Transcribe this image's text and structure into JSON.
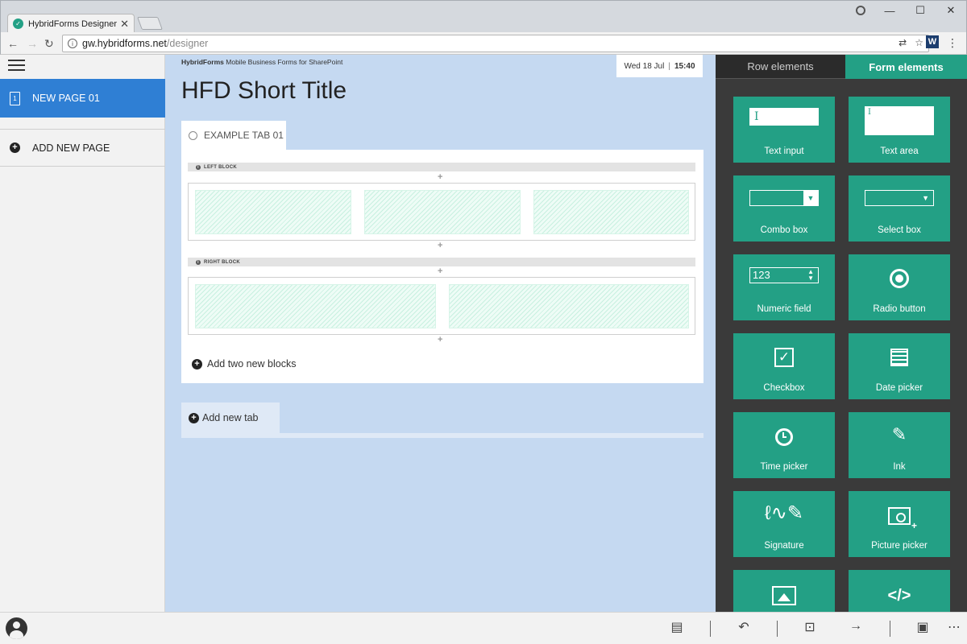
{
  "browser": {
    "tab_title": "HybridForms Designer",
    "tab_close": "✕",
    "url_host": "gw.hybridforms.net",
    "url_path": "/designer",
    "window_controls": {
      "minimize": "—",
      "maximize": "☐",
      "close": "✕"
    },
    "extension_label": "W"
  },
  "sidebar": {
    "pages": [
      {
        "label": "NEW PAGE 01",
        "number": "1",
        "selected": true
      }
    ],
    "add_page_label": "ADD NEW PAGE"
  },
  "canvas": {
    "brand_bold": "HybridForms",
    "brand_rest": " Mobile Business Forms for SharePoint",
    "date": "Wed 18 Jul",
    "date_sep": "|",
    "time": "15:40",
    "title": "HFD Short Title",
    "tab_label": "EXAMPLE TAB 01",
    "blocks": [
      {
        "header": "LEFT BLOCK",
        "columns": 3
      },
      {
        "header": "RIGHT BLOCK",
        "columns": 2
      }
    ],
    "add_blocks_label": "Add two new blocks",
    "add_tab_label": "Add new tab",
    "plus_mark": "+"
  },
  "panel": {
    "tabs": [
      {
        "label": "Row elements",
        "active": false
      },
      {
        "label": "Form elements",
        "active": true
      }
    ],
    "elements": [
      {
        "label": "Text input",
        "icon": "text-input-icon"
      },
      {
        "label": "Text area",
        "icon": "text-area-icon"
      },
      {
        "label": "Combo box",
        "icon": "combo-box-icon"
      },
      {
        "label": "Select box",
        "icon": "select-box-icon"
      },
      {
        "label": "Numeric field",
        "icon": "numeric-field-icon",
        "sample": "123"
      },
      {
        "label": "Radio button",
        "icon": "radio-button-icon"
      },
      {
        "label": "Checkbox",
        "icon": "checkbox-icon"
      },
      {
        "label": "Date picker",
        "icon": "calendar-icon"
      },
      {
        "label": "Time picker",
        "icon": "clock-icon"
      },
      {
        "label": "Ink",
        "icon": "pen-icon"
      },
      {
        "label": "Signature",
        "icon": "signature-icon"
      },
      {
        "label": "Picture picker",
        "icon": "picture-picker-icon"
      },
      {
        "label": "",
        "icon": "image-icon"
      },
      {
        "label": "",
        "icon": "code-icon"
      }
    ]
  },
  "colors": {
    "accent": "#23a085",
    "selected_page": "#2f7fd4",
    "canvas_bg": "#c5d9f1",
    "panel_bg": "#3a3a3a"
  }
}
